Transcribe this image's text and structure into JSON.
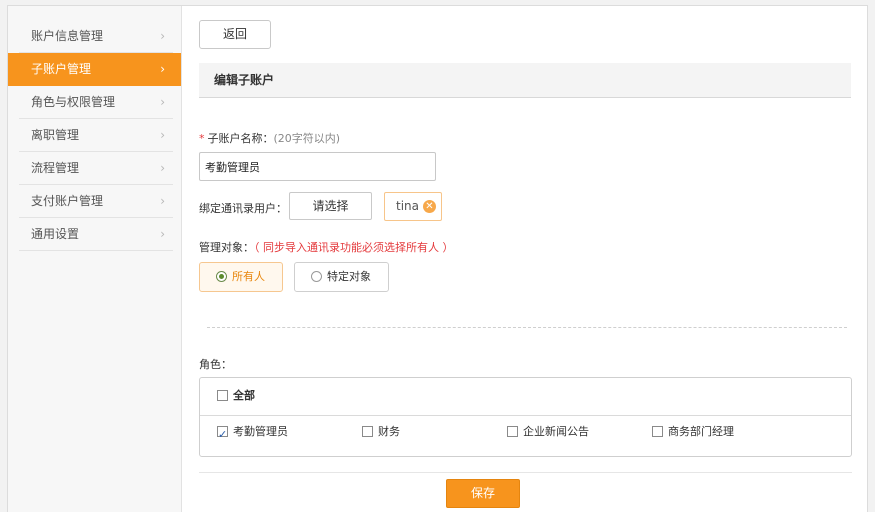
{
  "sidebar": {
    "items": [
      {
        "label": "账户信息管理",
        "active": false
      },
      {
        "label": "子账户管理",
        "active": true
      },
      {
        "label": "角色与权限管理",
        "active": false
      },
      {
        "label": "离职管理",
        "active": false
      },
      {
        "label": "流程管理",
        "active": false
      },
      {
        "label": "支付账户管理",
        "active": false
      },
      {
        "label": "通用设置",
        "active": false
      }
    ],
    "chevron": "›"
  },
  "toolbar": {
    "back_label": "返回"
  },
  "section": {
    "title": "编辑子账户"
  },
  "form": {
    "name_required_mark": "*",
    "name_label": "子账户名称：",
    "name_hint": "(20字符以内)",
    "name_value": "考勤管理员",
    "bind_label": "绑定通讯录用户：",
    "select_button": "请选择",
    "bound_user": "tina",
    "remove_icon": "✕",
    "manage_label": "管理对象：",
    "manage_warning": "（ 同步导入通讯录功能必须选择所有人 ）",
    "manage_options": [
      {
        "label": "所有人",
        "selected": true
      },
      {
        "label": "特定对象",
        "selected": false
      }
    ],
    "role_label": "角色：",
    "role_all": {
      "label": "全部",
      "checked": false
    },
    "roles": [
      {
        "label": "考勤管理员",
        "checked": true
      },
      {
        "label": "财务",
        "checked": false
      },
      {
        "label": "企业新闻公告",
        "checked": false
      },
      {
        "label": "商务部门经理",
        "checked": false
      }
    ],
    "save_label": "保存"
  },
  "colors": {
    "accent": "#f7941d",
    "warning": "#e4393c"
  }
}
